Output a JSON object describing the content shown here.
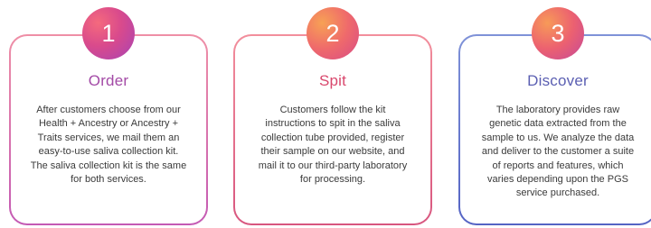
{
  "steps": [
    {
      "number": "1",
      "title": "Order",
      "description": "After customers choose from our\nHealth + Ancestry or Ancestry +\nTraits services, we mail them an\neasy-to-use saliva collection kit.\nThe saliva collection kit is the same\nfor both services."
    },
    {
      "number": "2",
      "title": "Spit",
      "description": "Customers follow the kit\ninstructions to spit in the saliva\ncollection tube provided, register\ntheir sample on our website, and\nmail it to our third-party laboratory\nfor processing."
    },
    {
      "number": "3",
      "title": "Discover",
      "description": "The laboratory provides raw\ngenetic data extracted from the\nsample to us. We analyze the data\nand deliver to the customer a suite\nof reports and features, which\nvaries depending upon the PGS\nservice purchased."
    }
  ],
  "colors": {
    "step_1_accent": "#a34aa6",
    "step_2_accent": "#d9486d",
    "step_3_accent": "#5b5fb2",
    "body_text": "#3a3a3a"
  }
}
